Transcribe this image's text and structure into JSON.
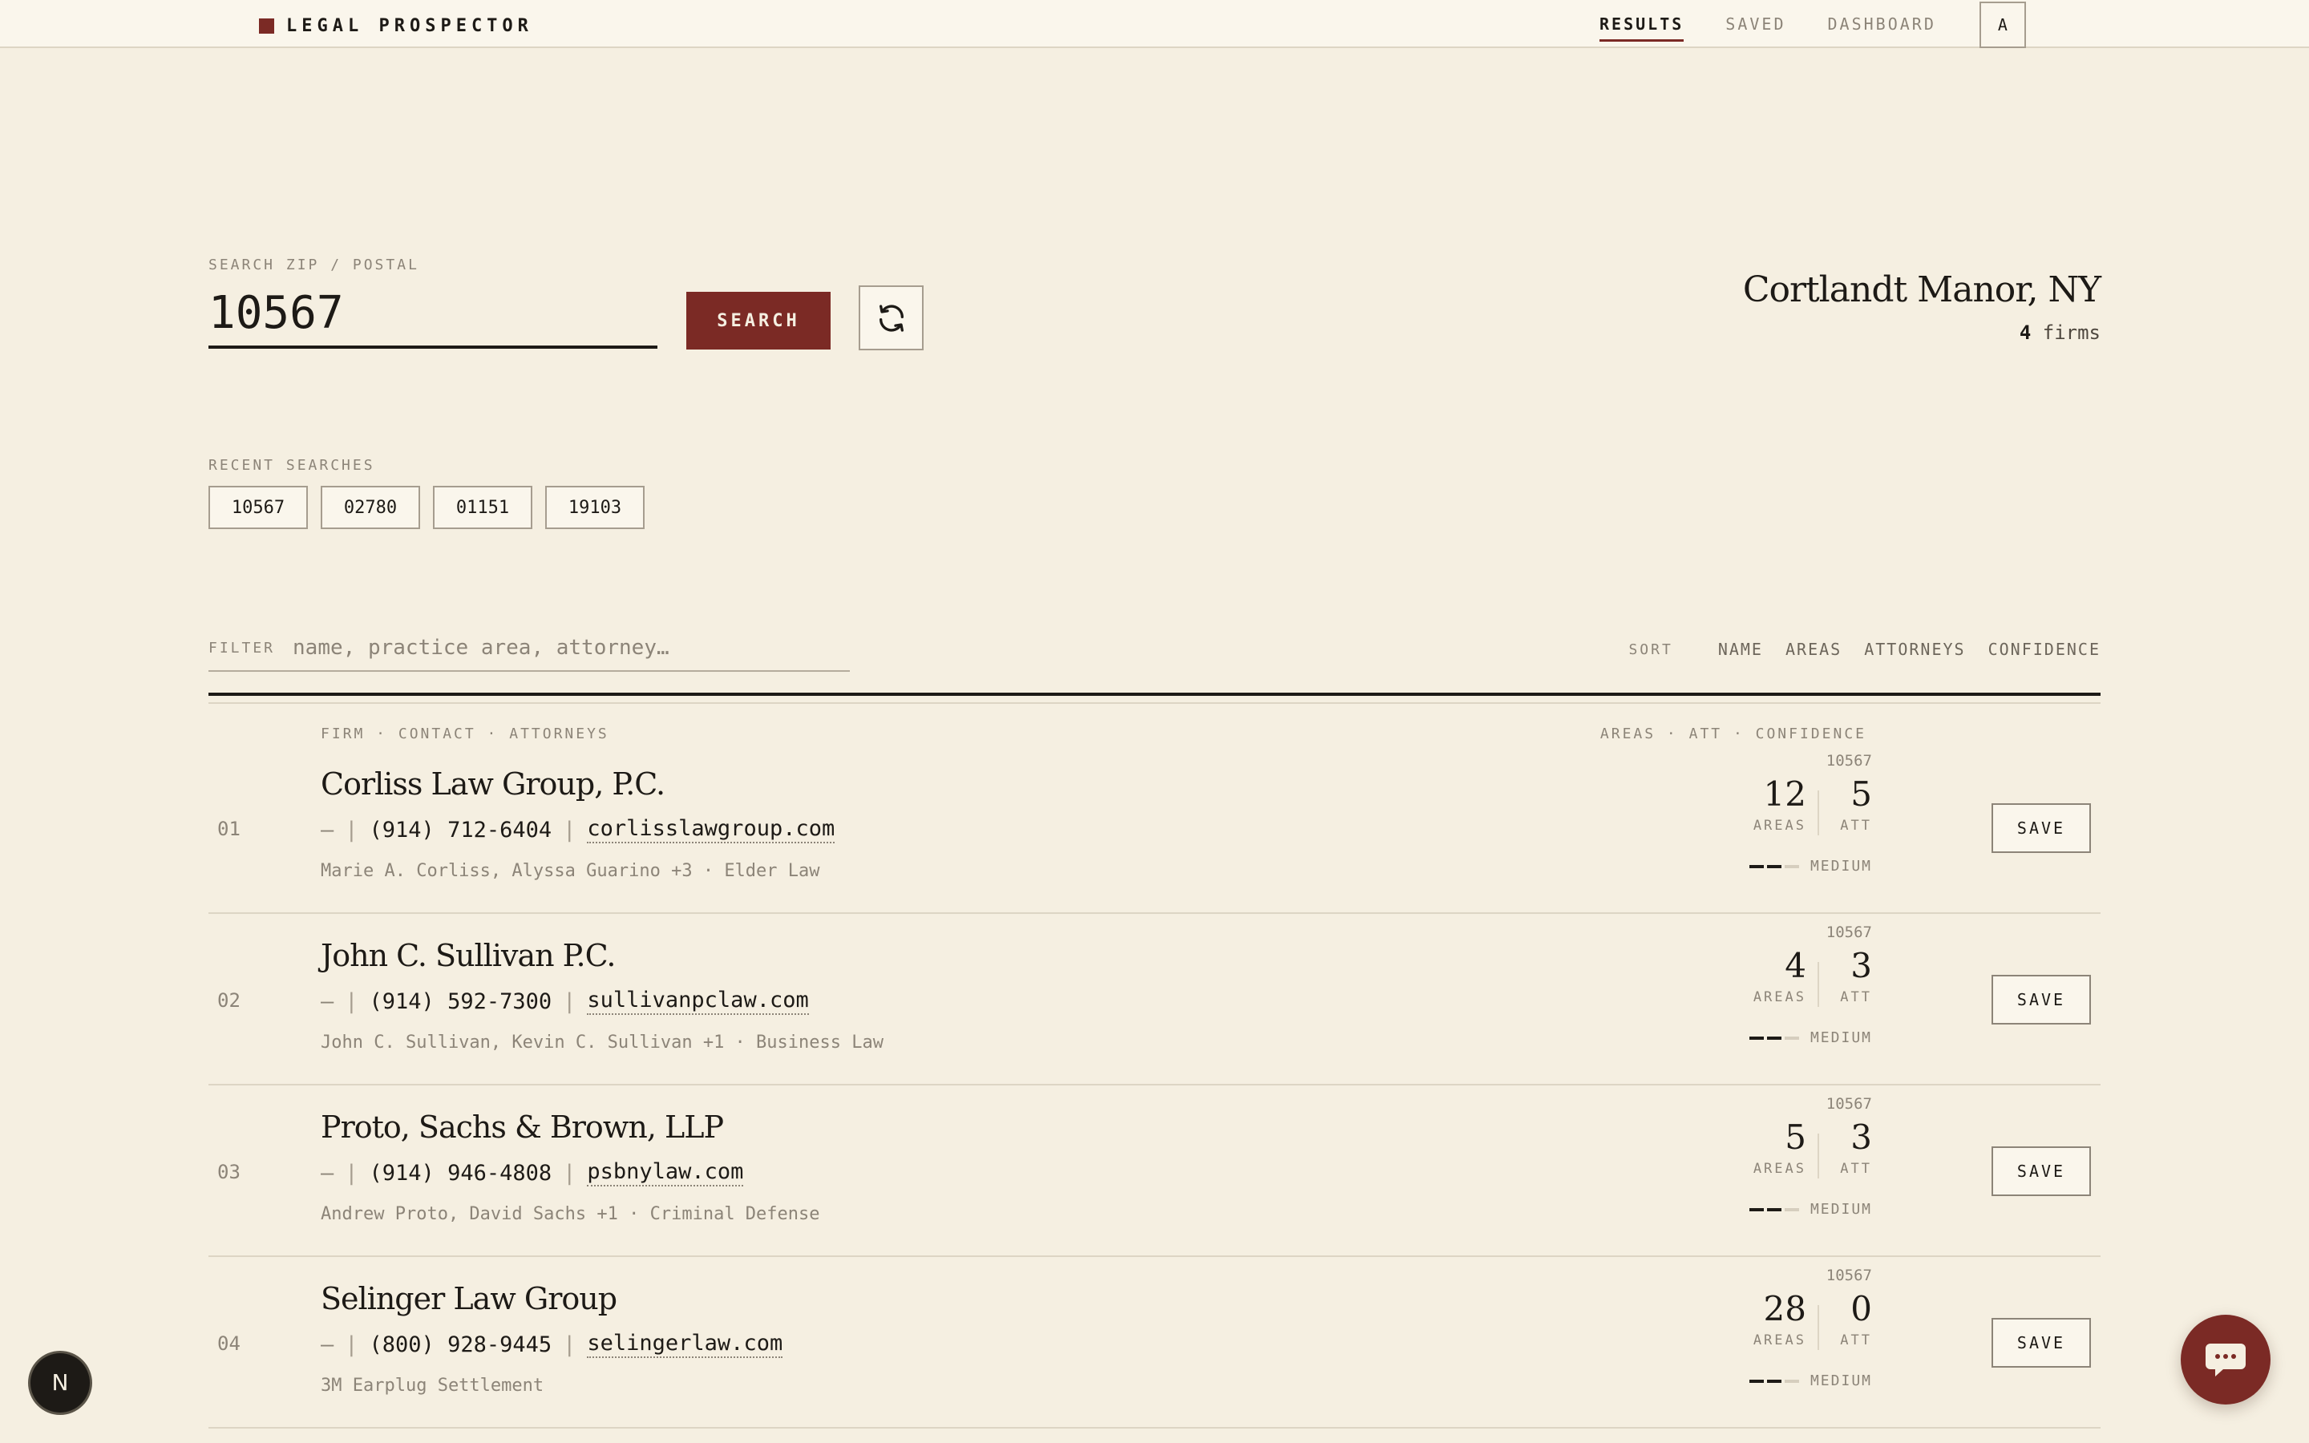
{
  "brand": {
    "name": "LEGAL PROSPECTOR"
  },
  "nav": {
    "results": "RESULTS",
    "saved": "SAVED",
    "dashboard": "DASHBOARD",
    "avatar": "A"
  },
  "search": {
    "label": "SEARCH ZIP / POSTAL",
    "value": "10567",
    "button": "SEARCH"
  },
  "location": {
    "name": "Cortlandt Manor, NY",
    "count": "4",
    "count_unit": "firms"
  },
  "recent": {
    "label": "RECENT SEARCHES",
    "items": [
      "10567",
      "02780",
      "01151",
      "19103"
    ]
  },
  "filter": {
    "label": "FILTER",
    "placeholder": "name, practice area, attorney…"
  },
  "sort": {
    "label": "SORT",
    "options": [
      "NAME",
      "AREAS",
      "ATTORNEYS",
      "CONFIDENCE"
    ]
  },
  "columns": {
    "left": "FIRM · CONTACT · ATTORNEYS",
    "right": "AREAS · ATT · CONFIDENCE"
  },
  "stat_units": {
    "areas": "AREAS",
    "att": "ATT"
  },
  "save_label": "SAVE",
  "firms": [
    {
      "num": "01",
      "name": "Corliss Law Group, P.C.",
      "dash": "—",
      "phone": "(914) 712-6404",
      "website": "corlisslawgroup.com",
      "attorneys": "Marie A. Corliss, Alyssa Guarino +3 · Elder Law",
      "zip": "10567",
      "areas": "12",
      "att": "5",
      "confidence": "MEDIUM",
      "confidence_level": 2
    },
    {
      "num": "02",
      "name": "John C. Sullivan P.C.",
      "dash": "—",
      "phone": "(914) 592-7300",
      "website": "sullivanpclaw.com",
      "attorneys": "John C. Sullivan, Kevin C. Sullivan +1 · Business Law",
      "zip": "10567",
      "areas": "4",
      "att": "3",
      "confidence": "MEDIUM",
      "confidence_level": 2
    },
    {
      "num": "03",
      "name": "Proto, Sachs & Brown, LLP",
      "dash": "—",
      "phone": "(914) 946-4808",
      "website": "psbnylaw.com",
      "attorneys": "Andrew Proto, David Sachs +1 · Criminal Defense",
      "zip": "10567",
      "areas": "5",
      "att": "3",
      "confidence": "MEDIUM",
      "confidence_level": 2
    },
    {
      "num": "04",
      "name": "Selinger Law Group",
      "dash": "—",
      "phone": "(800) 928-9445",
      "website": "selingerlaw.com",
      "attorneys": "3M Earplug Settlement",
      "zip": "10567",
      "areas": "28",
      "att": "0",
      "confidence": "MEDIUM",
      "confidence_level": 2
    }
  ],
  "badge": {
    "letter": "N"
  },
  "colors": {
    "accent": "#7b2a25",
    "background": "#f5efe1",
    "ink": "#1d1a16",
    "muted": "#8c8478"
  }
}
